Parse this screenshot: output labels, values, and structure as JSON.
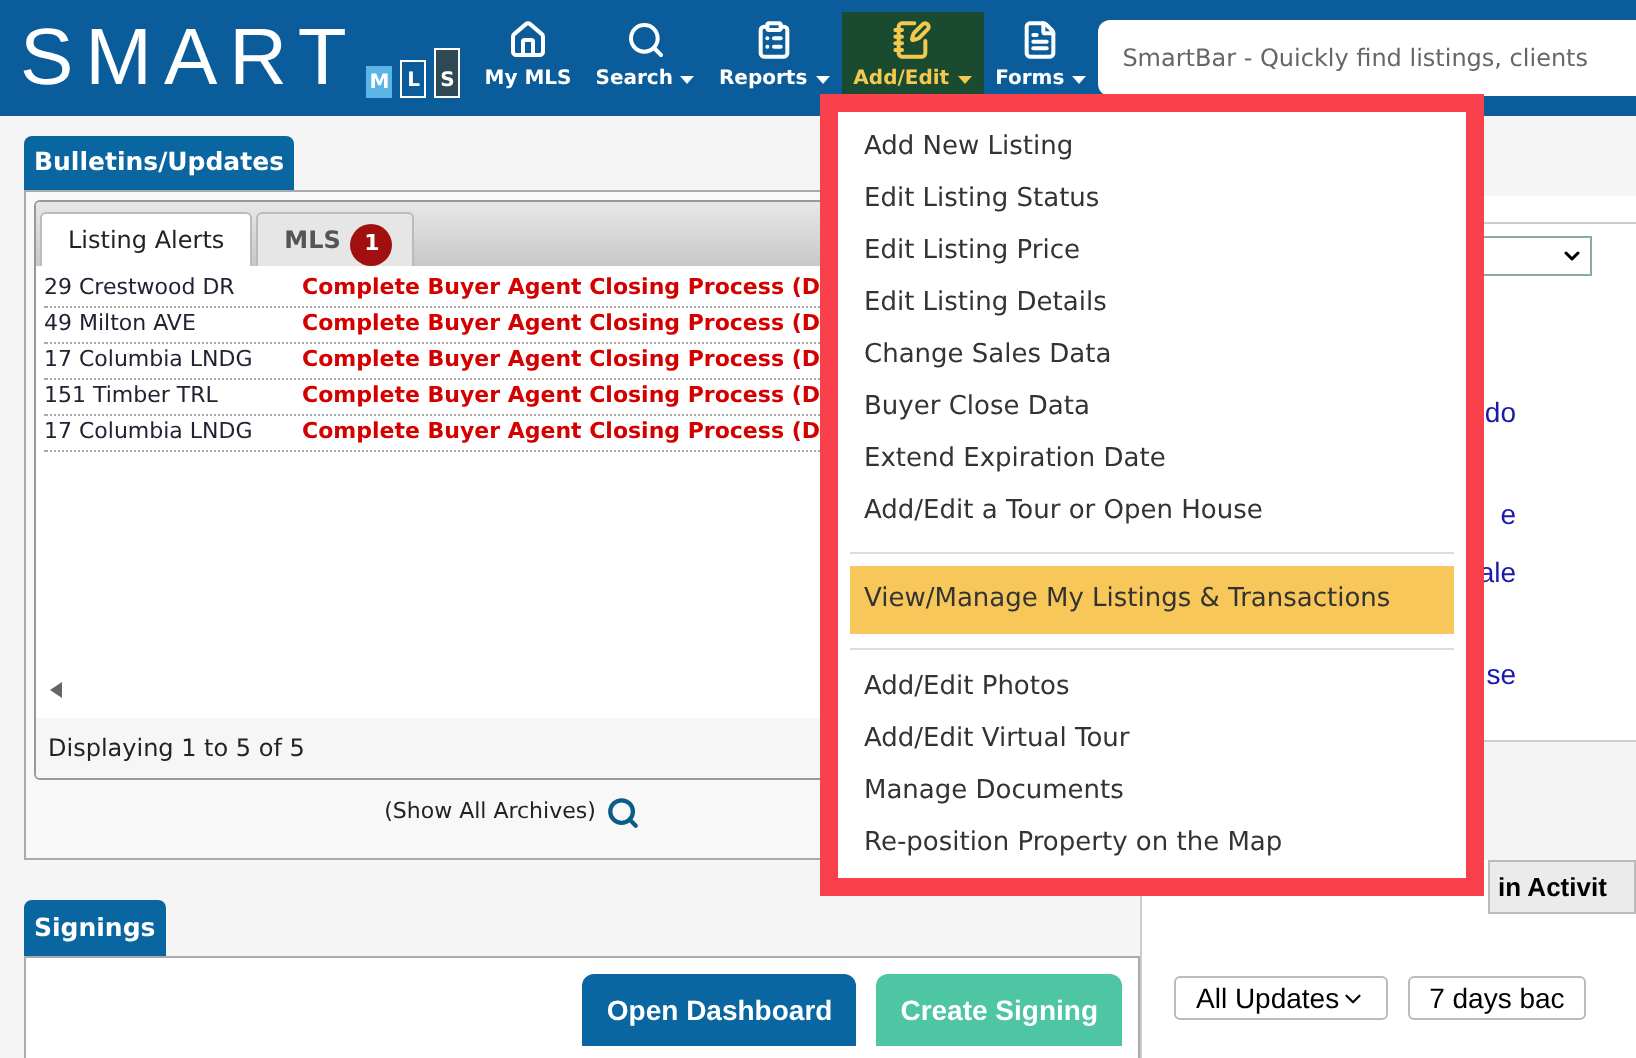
{
  "header": {
    "logo": {
      "text": "SMART",
      "letters": [
        "M",
        "L",
        "S"
      ]
    },
    "nav": [
      {
        "label": "My MLS",
        "caret": false,
        "selected": false
      },
      {
        "label": "Search",
        "caret": true,
        "selected": false
      },
      {
        "label": "Reports",
        "caret": true,
        "selected": false
      },
      {
        "label": "Add/Edit",
        "caret": true,
        "selected": true
      },
      {
        "label": "Forms",
        "caret": true,
        "selected": false
      }
    ],
    "smartbar": {
      "placeholder": "SmartBar - Quickly find listings, clients"
    }
  },
  "bulletins": {
    "title": "Bulletins/Updates",
    "tabs": [
      {
        "label": "Listing Alerts",
        "selected": true
      },
      {
        "label": "MLS",
        "selected": false,
        "badge": "1"
      }
    ],
    "rows": [
      {
        "address": "29 Crestwood DR",
        "alert": "Complete Buyer Agent Closing Process (D"
      },
      {
        "address": "49 Milton AVE",
        "alert": "Complete Buyer Agent Closing Process (D"
      },
      {
        "address": "17 Columbia LNDG",
        "alert": "Complete Buyer Agent Closing Process (D"
      },
      {
        "address": "151 Timber TRL",
        "alert": "Complete Buyer Agent Closing Process (D"
      },
      {
        "address": "17 Columbia LNDG",
        "alert": "Complete Buyer Agent Closing Process (D"
      }
    ],
    "status": "Displaying 1 to 5 of 5",
    "archives_link": "(Show All Archives)"
  },
  "signings": {
    "title": "Signings",
    "buttons": [
      {
        "label": "Open Dashboard",
        "kind": "primary"
      },
      {
        "label": "Create Signing",
        "kind": "secondary"
      }
    ]
  },
  "right_panel": {
    "links": [
      "do",
      "e",
      "ale",
      "se"
    ],
    "tab": "in Activit",
    "filters": [
      "All Updates",
      "7 days bac"
    ]
  },
  "menu": {
    "groups": [
      [
        {
          "label": "Add New Listing",
          "selected": false
        },
        {
          "label": "Edit Listing Status",
          "selected": false
        },
        {
          "label": "Edit Listing Price",
          "selected": false
        },
        {
          "label": "Edit Listing Details",
          "selected": false
        },
        {
          "label": "Change Sales Data",
          "selected": false
        },
        {
          "label": "Buyer Close Data",
          "selected": false
        },
        {
          "label": "Extend Expiration Date",
          "selected": false
        },
        {
          "label": "Add/Edit a Tour or Open House",
          "selected": false
        }
      ],
      [
        {
          "label": "View/Manage My Listings & Transactions",
          "selected": true
        }
      ],
      [
        {
          "label": "Add/Edit Photos",
          "selected": false
        },
        {
          "label": "Add/Edit Virtual Tour",
          "selected": false
        },
        {
          "label": "Manage Documents",
          "selected": false
        },
        {
          "label": "Re-position Property on the Map",
          "selected": false
        }
      ]
    ]
  }
}
